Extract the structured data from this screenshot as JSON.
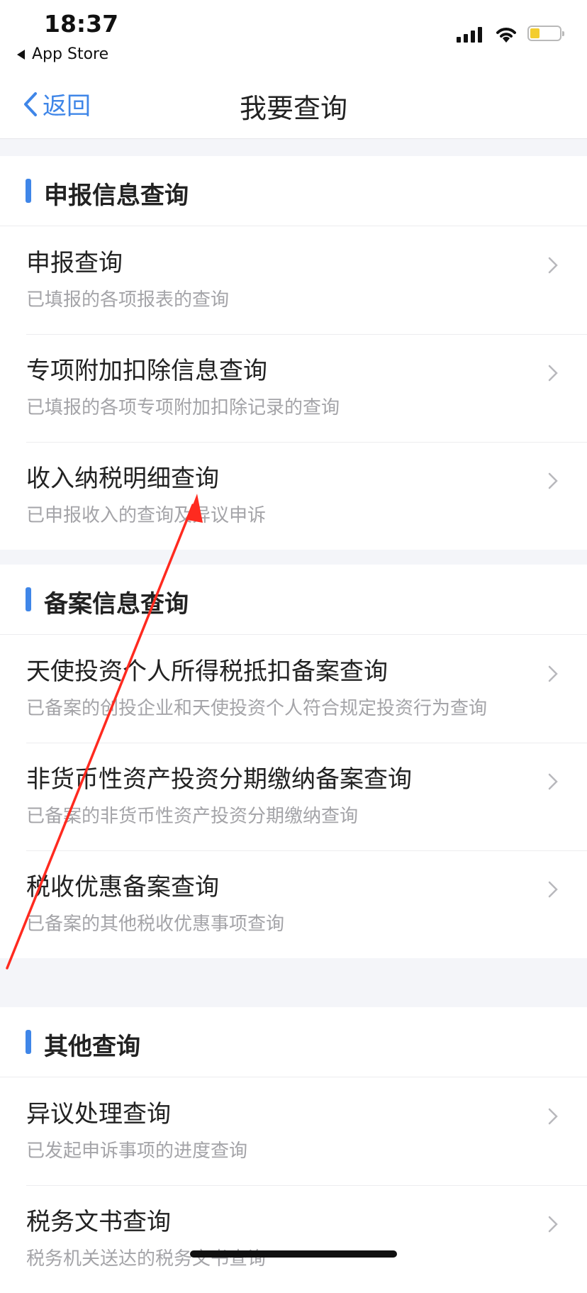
{
  "status": {
    "time": "18:37",
    "back_app": "App Store"
  },
  "nav": {
    "back_label": "返回",
    "title": "我要查询"
  },
  "sections": [
    {
      "title": "申报信息查询",
      "items": [
        {
          "title": "申报查询",
          "desc": "已填报的各项报表的查询"
        },
        {
          "title": "专项附加扣除信息查询",
          "desc": "已填报的各项专项附加扣除记录的查询"
        },
        {
          "title": "收入纳税明细查询",
          "desc": "已申报收入的查询及异议申诉"
        }
      ]
    },
    {
      "title": "备案信息查询",
      "items": [
        {
          "title": "天使投资个人所得税抵扣备案查询",
          "desc": "已备案的创投企业和天使投资个人符合规定投资行为查询"
        },
        {
          "title": "非货币性资产投资分期缴纳备案查询",
          "desc": "已备案的非货币性资产投资分期缴纳查询"
        },
        {
          "title": "税收优惠备案查询",
          "desc": "已备案的其他税收优惠事项查询"
        }
      ]
    },
    {
      "title": "其他查询",
      "items": [
        {
          "title": "异议处理查询",
          "desc": "已发起申诉事项的进度查询"
        },
        {
          "title": "税务文书查询",
          "desc": "税务机关送达的税务文书查询"
        }
      ]
    }
  ],
  "colors": {
    "accent": "#3f86e8",
    "annotation": "#ff2a1f"
  }
}
